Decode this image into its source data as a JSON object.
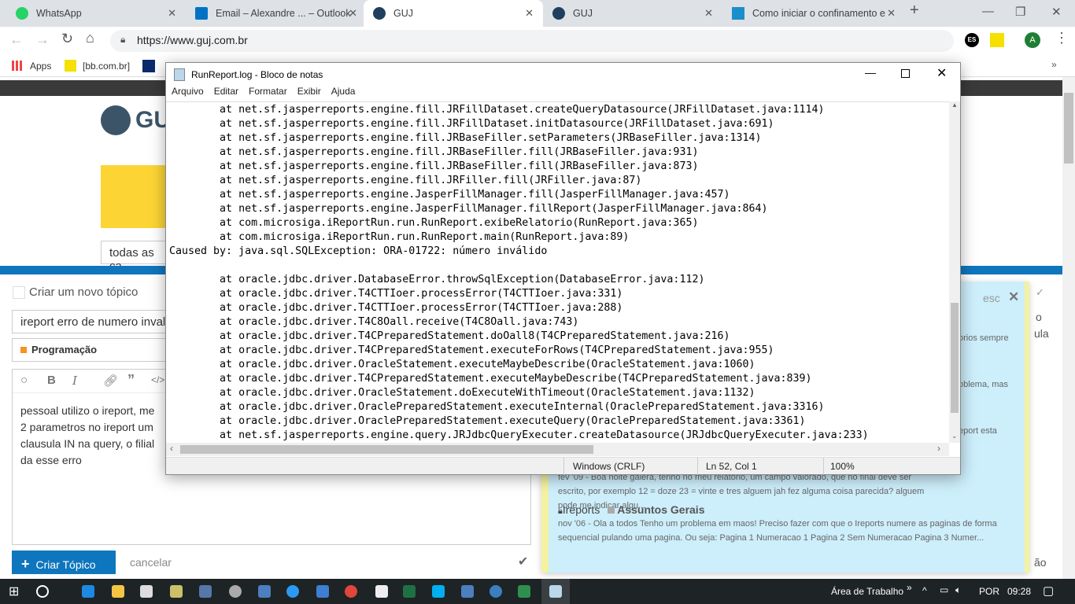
{
  "browser": {
    "tabs": [
      {
        "title": "WhatsApp",
        "icon": "whatsapp-icon"
      },
      {
        "title": "Email – Alexandre ... – Outlook",
        "icon": "outlook-icon"
      },
      {
        "title": "GUJ",
        "icon": "guj-icon"
      },
      {
        "title": "GUJ",
        "icon": "guj-icon"
      },
      {
        "title": "Como iniciar o confinamento e",
        "icon": "bs-icon"
      }
    ],
    "new_tab": "+",
    "url": "https://www.guj.com.br",
    "profile_initial": "A",
    "ext_es": "ES",
    "bookmarks": [
      "Apps",
      "[bb.com.br]"
    ],
    "more_bookmarks": "»"
  },
  "page": {
    "logo": "GU",
    "category_filter": "todas as ca",
    "composer": {
      "header": "Criar um novo tópico",
      "title_value": "ireport erro de numero inval",
      "category": "Programação",
      "category_color": "#f7941d",
      "body_lines": [
        "pessoal utilizo o ireport, me",
        "2 parametros no ireport um",
        "clausula IN na query, o filial",
        "da esse erro"
      ],
      "create_button": "Criar Tópico",
      "cancel": "cancelar"
    },
    "similar": {
      "esc": "esc",
      "snippets": [
        "orios sempre",
        "oblema, mas",
        "eport esta"
      ],
      "right_fragments": [
        "o",
        "ula",
        "ão"
      ],
      "items": [
        {
          "excerpt": "fev '09 - Boa noite galera, tenho no meu relatorio, um campo valorado, que no final deve ser escrito, por exemplo 12 = doze 23 = vinte e tres alguem jah fez alguma coisa parecida? alguem pode me indicar algu..."
        },
        {
          "title": "Ireports",
          "category": "Assuntos Gerais",
          "excerpt": "nov '06 - Ola a todos Tenho um problema em maos! Preciso fazer com que o Ireports numere as paginas de forma sequencial pulando uma pagina. Ou seja: Pagina 1 Numeracao 1 Pagina 2 Sem Numeracao Pagina 3 Numer..."
        }
      ]
    }
  },
  "notepad": {
    "title": "RunReport.log - Bloco de notas",
    "menu": [
      "Arquivo",
      "Editar",
      "Formatar",
      "Exibir",
      "Ajuda"
    ],
    "lines": [
      "\tat net.sf.jasperreports.engine.fill.JRFillDataset.createQueryDatasource(JRFillDataset.java:1114)",
      "\tat net.sf.jasperreports.engine.fill.JRFillDataset.initDatasource(JRFillDataset.java:691)",
      "\tat net.sf.jasperreports.engine.fill.JRBaseFiller.setParameters(JRBaseFiller.java:1314)",
      "\tat net.sf.jasperreports.engine.fill.JRBaseFiller.fill(JRBaseFiller.java:931)",
      "\tat net.sf.jasperreports.engine.fill.JRBaseFiller.fill(JRBaseFiller.java:873)",
      "\tat net.sf.jasperreports.engine.fill.JRFiller.fill(JRFiller.java:87)",
      "\tat net.sf.jasperreports.engine.JasperFillManager.fill(JasperFillManager.java:457)",
      "\tat net.sf.jasperreports.engine.JasperFillManager.fillReport(JasperFillManager.java:864)",
      "\tat com.microsiga.iReportRun.run.RunReport.exibeRelatorio(RunReport.java:365)",
      "\tat com.microsiga.iReportRun.run.RunReport.main(RunReport.java:89)",
      "Caused by: java.sql.SQLException: ORA-01722: número inválido",
      "",
      "\tat oracle.jdbc.driver.DatabaseError.throwSqlException(DatabaseError.java:112)",
      "\tat oracle.jdbc.driver.T4CTTIoer.processError(T4CTTIoer.java:331)",
      "\tat oracle.jdbc.driver.T4CTTIoer.processError(T4CTTIoer.java:288)",
      "\tat oracle.jdbc.driver.T4C8Oall.receive(T4C8Oall.java:743)",
      "\tat oracle.jdbc.driver.T4CPreparedStatement.doOall8(T4CPreparedStatement.java:216)",
      "\tat oracle.jdbc.driver.T4CPreparedStatement.executeForRows(T4CPreparedStatement.java:955)",
      "\tat oracle.jdbc.driver.OracleStatement.executeMaybeDescribe(OracleStatement.java:1060)",
      "\tat oracle.jdbc.driver.T4CPreparedStatement.executeMaybeDescribe(T4CPreparedStatement.java:839)",
      "\tat oracle.jdbc.driver.OracleStatement.doExecuteWithTimeout(OracleStatement.java:1132)",
      "\tat oracle.jdbc.driver.OraclePreparedStatement.executeInternal(OraclePreparedStatement.java:3316)",
      "\tat oracle.jdbc.driver.OraclePreparedStatement.executeQuery(OraclePreparedStatement.java:3361)",
      "\tat net.sf.jasperreports.engine.query.JRJdbcQueryExecuter.createDatasource(JRJdbcQueryExecuter.java:233)"
    ],
    "status": {
      "encoding": "Windows (CRLF)",
      "position": "Ln 52, Col 1",
      "zoom": "100%"
    }
  },
  "taskbar": {
    "desktop_label": "Área de Trabalho",
    "language": "POR",
    "time": "09:28"
  }
}
